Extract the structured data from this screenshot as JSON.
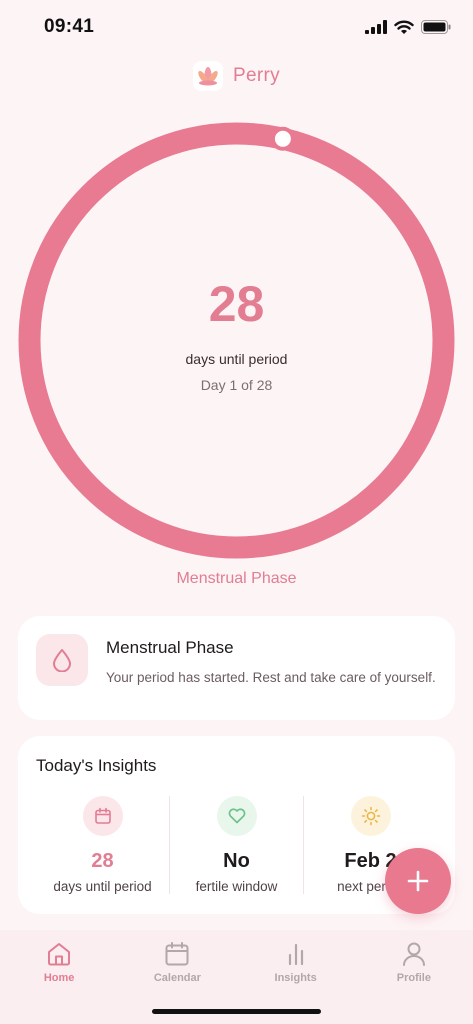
{
  "status_bar": {
    "time": "09:41"
  },
  "app": {
    "name": "Perry"
  },
  "cycle": {
    "days_until_period": "28",
    "days_label": "days until period",
    "day_of": "Day 1 of 28",
    "phase_label": "Menstrual Phase",
    "progress_fraction": 0.036,
    "ring_color": "#e87a91"
  },
  "phase_card": {
    "icon": "drop-icon",
    "title": "Menstrual Phase",
    "description": "Your period has started. Rest and take care of yourself."
  },
  "insights": {
    "title": "Today's Insights",
    "items": [
      {
        "icon": "calendar-icon",
        "value": "28",
        "label": "days until period"
      },
      {
        "icon": "heart-icon",
        "value": "No",
        "label": "fertile window"
      },
      {
        "icon": "sun-icon",
        "value": "Feb 2",
        "label": "next period"
      }
    ]
  },
  "fab": {
    "icon": "plus-icon"
  },
  "tabs": [
    {
      "icon": "home-icon",
      "label": "Home",
      "active": true
    },
    {
      "icon": "calendar-icon",
      "label": "Calendar",
      "active": false
    },
    {
      "icon": "bar-chart-icon",
      "label": "Insights",
      "active": false
    },
    {
      "icon": "person-icon",
      "label": "Profile",
      "active": false
    }
  ],
  "colors": {
    "accent": "#e27d92",
    "background": "#fdf4f6"
  }
}
